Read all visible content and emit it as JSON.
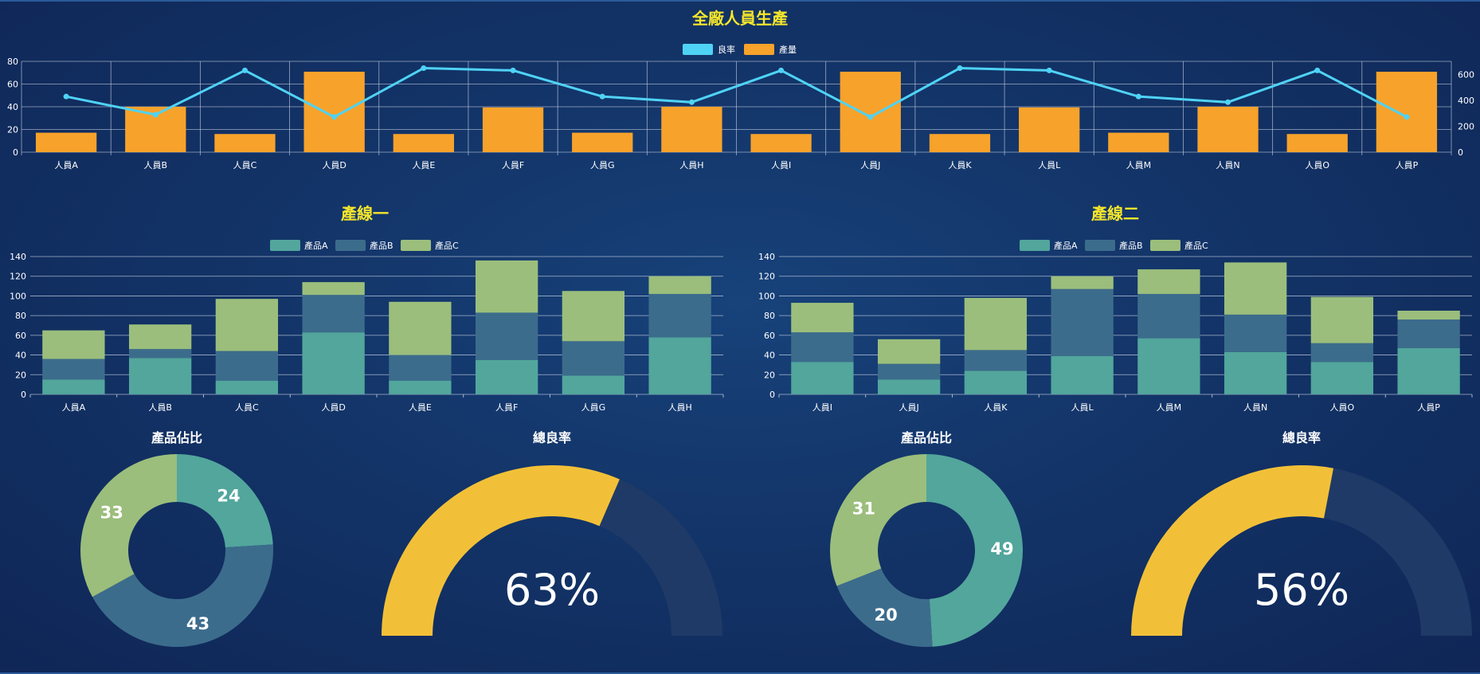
{
  "page_title": "全廠人員生產",
  "colors": {
    "title": "#f5e62b",
    "yield_line": "#4fd3f5",
    "output_bar": "#f7a22b",
    "product_a": "#52a69c",
    "product_b": "#3c6c8c",
    "product_c": "#9bbe7c",
    "gauge_fill": "#f2c038",
    "gauge_track": "#1f3a66",
    "axis": "#c8d2e2"
  },
  "chart_data": [
    {
      "type": "bar",
      "id": "overview",
      "legend": [
        "良率",
        "產量"
      ],
      "categories": [
        "人員A",
        "人員B",
        "人員C",
        "人員D",
        "人員E",
        "人員F",
        "人員G",
        "人員H",
        "人員I",
        "人員J",
        "人員K",
        "人員L",
        "人員M",
        "人員N",
        "人員O",
        "人員P"
      ],
      "series": [
        {
          "name": "產量",
          "type": "bar",
          "axis": "right",
          "values": [
            150,
            350,
            140,
            620,
            140,
            345,
            150,
            350,
            140,
            620,
            140,
            345,
            150,
            350,
            140,
            620
          ]
        },
        {
          "name": "良率",
          "type": "line",
          "axis": "left",
          "values": [
            49,
            33,
            72,
            31,
            74,
            72,
            49,
            44,
            72,
            31,
            74,
            72,
            49,
            44,
            72,
            31
          ]
        }
      ],
      "y_left": {
        "ylim": [
          0,
          80
        ],
        "ticks": [
          0,
          20,
          40,
          60,
          80
        ]
      },
      "y_right": {
        "ylim": [
          0,
          700
        ],
        "ticks": [
          0,
          200,
          400,
          600
        ]
      },
      "grid": true
    },
    {
      "type": "bar",
      "stacked": true,
      "id": "line1",
      "title": "產線一",
      "legend": [
        "產品A",
        "產品B",
        "產品C"
      ],
      "categories": [
        "人員A",
        "人員B",
        "人員C",
        "人員D",
        "人員E",
        "人員F",
        "人員G",
        "人員H"
      ],
      "series": [
        {
          "name": "產品A",
          "values": [
            15,
            37,
            14,
            63,
            14,
            35,
            19,
            58
          ]
        },
        {
          "name": "產品B",
          "values": [
            21,
            9,
            30,
            38,
            26,
            48,
            35,
            44
          ]
        },
        {
          "name": "產品C",
          "values": [
            29,
            25,
            53,
            13,
            54,
            53,
            51,
            18
          ]
        }
      ],
      "ylim": [
        0,
        140
      ],
      "ticks": [
        0,
        20,
        40,
        60,
        80,
        100,
        120,
        140
      ],
      "grid": true
    },
    {
      "type": "bar",
      "stacked": true,
      "id": "line2",
      "title": "產線二",
      "legend": [
        "產品A",
        "產品B",
        "產品C"
      ],
      "categories": [
        "人員I",
        "人員J",
        "人員K",
        "人員L",
        "人員M",
        "人員N",
        "人員O",
        "人員P"
      ],
      "series": [
        {
          "name": "產品A",
          "values": [
            33,
            15,
            24,
            39,
            57,
            43,
            33,
            47
          ]
        },
        {
          "name": "產品B",
          "values": [
            30,
            16,
            21,
            68,
            45,
            38,
            19,
            29
          ]
        },
        {
          "name": "產品C",
          "values": [
            30,
            25,
            53,
            13,
            25,
            53,
            47,
            9
          ]
        }
      ],
      "ylim": [
        0,
        140
      ],
      "ticks": [
        0,
        20,
        40,
        60,
        80,
        100,
        120,
        140
      ],
      "grid": true
    },
    {
      "type": "pie",
      "id": "pie1",
      "title": "產品佔比",
      "slices": [
        {
          "name": "產品A",
          "value": 24
        },
        {
          "name": "產品B",
          "value": 43
        },
        {
          "name": "產品C",
          "value": 33
        }
      ]
    },
    {
      "type": "gauge",
      "id": "gauge1",
      "title": "總良率",
      "value": 63,
      "label": "63%"
    },
    {
      "type": "pie",
      "id": "pie2",
      "title": "產品佔比",
      "slices": [
        {
          "name": "產品A",
          "value": 49
        },
        {
          "name": "產品B",
          "value": 20
        },
        {
          "name": "產品C",
          "value": 31
        }
      ]
    },
    {
      "type": "gauge",
      "id": "gauge2",
      "title": "總良率",
      "value": 56,
      "label": "56%"
    }
  ]
}
